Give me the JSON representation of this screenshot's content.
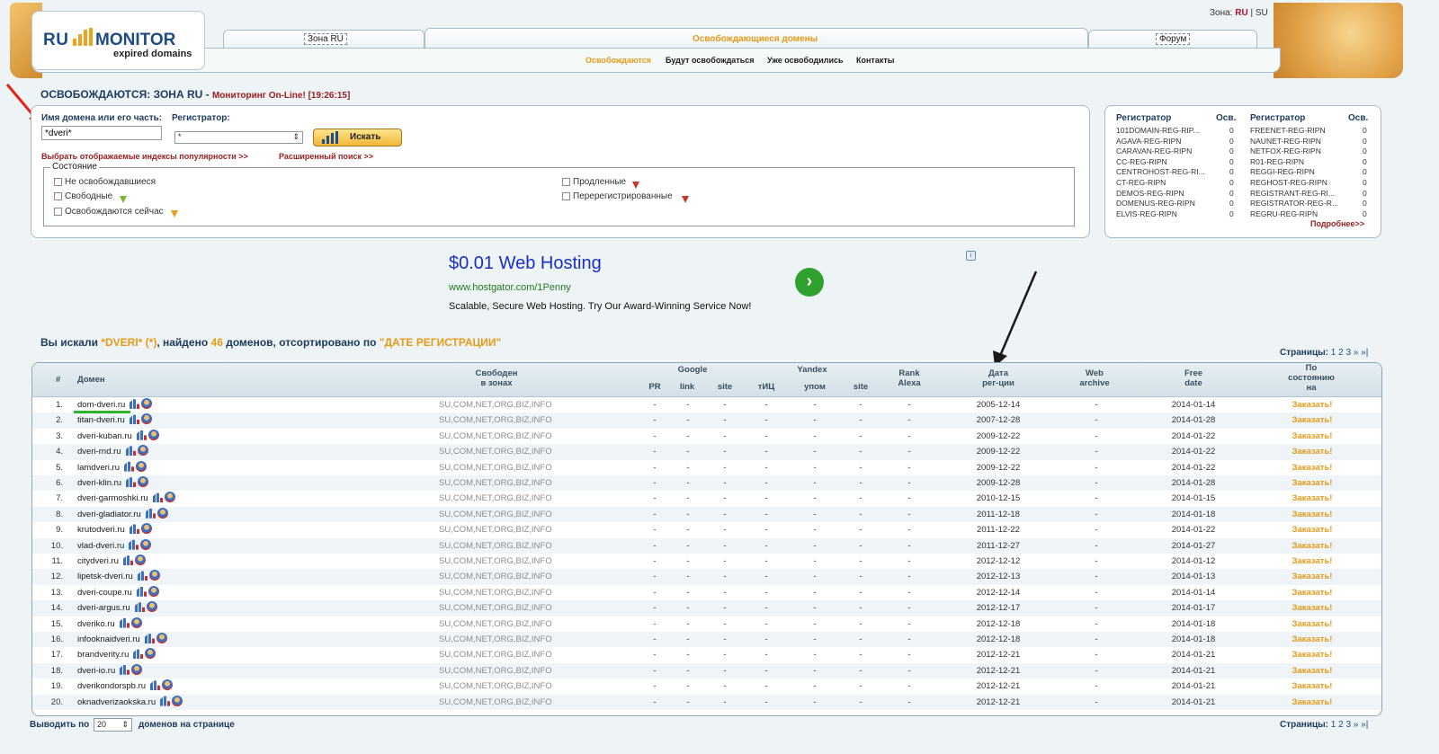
{
  "header": {
    "logo_ru": "RU",
    "logo_monitor": "MONITOR",
    "logo_sub": "expired domains",
    "zone_label": "Зона:",
    "zone_ru": "RU",
    "zone_sep": "|",
    "zone_su": "SU",
    "tabs": [
      {
        "label": "Зона RU"
      },
      {
        "label": "Освобождающиеся домены"
      },
      {
        "label": "Форум"
      }
    ],
    "subnav": [
      "Освобождаются",
      "Будут освобождаться",
      "Уже освободились",
      "Контакты"
    ],
    "colors": {
      "brand": "#1d4c86",
      "accent": "#e69a18",
      "alert": "#9b1c1c"
    }
  },
  "title": {
    "main": "ОСВОБОЖДАЮТСЯ: ЗОНА RU",
    "sep": "-",
    "monitor": "Мониторинг On-Line! [19:26:15]"
  },
  "search": {
    "domain_label": "Имя домена или его часть:",
    "registrar_label": "Регистратор:",
    "domain_value": "*dveri*",
    "registrar_value": "*",
    "button_label": "Искать",
    "link_indices": "Выбрать отображаемые индексы популярности >>",
    "link_advanced": "Расширенный поиск >>",
    "state_legend": "Состояние",
    "states": [
      "Не освобождавшиеся",
      "Свободные",
      "Освобождаются сейчас",
      "Продленные",
      "Перерегистрированные"
    ]
  },
  "registrars": {
    "head_name": "Регистратор",
    "head_count": "Осв.",
    "left": [
      {
        "name": "101DOMAIN-REG-RIP...",
        "count": "0"
      },
      {
        "name": "AGAVA-REG-RIPN",
        "count": "0"
      },
      {
        "name": "CARAVAN-REG-RIPN",
        "count": "0"
      },
      {
        "name": "CC-REG-RIPN",
        "count": "0"
      },
      {
        "name": "CENTROHOST-REG-RI...",
        "count": "0"
      },
      {
        "name": "CT-REG-RIPN",
        "count": "0"
      },
      {
        "name": "DEMOS-REG-RIPN",
        "count": "0"
      },
      {
        "name": "DOMENUS-REG-RIPN",
        "count": "0"
      },
      {
        "name": "ELVIS-REG-RIPN",
        "count": "0"
      }
    ],
    "right": [
      {
        "name": "FREENET-REG-RIPN",
        "count": "0"
      },
      {
        "name": "NAUNET-REG-RIPN",
        "count": "0"
      },
      {
        "name": "NETFOX-REG-RIPN",
        "count": "0"
      },
      {
        "name": "R01-REG-RIPN",
        "count": "0"
      },
      {
        "name": "REGGI-REG-RIPN",
        "count": "0"
      },
      {
        "name": "REGHOST-REG-RIPN",
        "count": "0"
      },
      {
        "name": "REGISTRANT-REG-RI...",
        "count": "0"
      },
      {
        "name": "REGISTRATOR-REG-R...",
        "count": "0"
      },
      {
        "name": "REGRU-REG-RIPN",
        "count": "0"
      }
    ],
    "more_link": "Подробнее>>"
  },
  "ad": {
    "title": "$0.01 Web Hosting",
    "url": "www.hostgator.com/1Penny",
    "desc": "Scalable, Secure Web Hosting. Try Our Award-Winning Service Now!",
    "go_glyph": "›",
    "info_glyph": "i"
  },
  "results": {
    "prefix": "Вы искали",
    "query": "*DVERI* (*)",
    "found_prefix": ", найдено",
    "count": "46",
    "found_suffix": "доменов, отсортировано по",
    "sort": "\"ДАТЕ РЕГИСТРАЦИИ\"",
    "pages_label": "Страницы:",
    "pages": "1 2 3 » »|"
  },
  "table": {
    "headers": {
      "num": "#",
      "domain": "Домен",
      "free_in_1": "Свободен",
      "free_in_2": "в зонах",
      "google": "Google",
      "pr": "PR",
      "link": "link",
      "site": "site",
      "yandex": "Yandex",
      "tic": "тИЦ",
      "upom": "упом",
      "ysite": "site",
      "rank_1": "Rank",
      "rank_2": "Alexa",
      "regdate_1": "Дата",
      "regdate_2": "рег-ции",
      "archive_1": "Web",
      "archive_2": "archive",
      "freedate_1": "Free",
      "freedate_2": "date",
      "bystate_1": "По",
      "bystate_2": "состоянию",
      "bystate_3": "на"
    },
    "rows": [
      {
        "n": "1.",
        "domain": "dom-dveri.ru",
        "zones": "SU,COM,NET,ORG,BIZ,INFO",
        "reg": "2005-12-14",
        "free": "2014-01-14",
        "dash": "-",
        "order": "Заказать!"
      },
      {
        "n": "2.",
        "domain": "titan-dveri.ru",
        "zones": "SU,COM,NET,ORG,BIZ,INFO",
        "reg": "2007-12-28",
        "free": "2014-01-28",
        "dash": "-",
        "order": "Заказать!"
      },
      {
        "n": "3.",
        "domain": "dveri-kuban.ru",
        "zones": "SU,COM,NET,ORG,BIZ,INFO",
        "reg": "2009-12-22",
        "free": "2014-01-22",
        "dash": "-",
        "order": "Заказать!"
      },
      {
        "n": "4.",
        "domain": "dveri-rnd.ru",
        "zones": "SU,COM,NET,ORG,BIZ,INFO",
        "reg": "2009-12-22",
        "free": "2014-01-22",
        "dash": "-",
        "order": "Заказать!"
      },
      {
        "n": "5.",
        "domain": "lamdveri.ru",
        "zones": "SU,COM,NET,ORG,BIZ,INFO",
        "reg": "2009-12-22",
        "free": "2014-01-22",
        "dash": "-",
        "order": "Заказать!"
      },
      {
        "n": "6.",
        "domain": "dveri-klin.ru",
        "zones": "SU,COM,NET,ORG,BIZ,INFO",
        "reg": "2009-12-28",
        "free": "2014-01-28",
        "dash": "-",
        "order": "Заказать!"
      },
      {
        "n": "7.",
        "domain": "dveri-garmoshki.ru",
        "zones": "SU,COM,NET,ORG,BIZ,INFO",
        "reg": "2010-12-15",
        "free": "2014-01-15",
        "dash": "-",
        "order": "Заказать!"
      },
      {
        "n": "8.",
        "domain": "dveri-gladiator.ru",
        "zones": "SU,COM,NET,ORG,BIZ,INFO",
        "reg": "2011-12-18",
        "free": "2014-01-18",
        "dash": "-",
        "order": "Заказать!"
      },
      {
        "n": "9.",
        "domain": "krutodveri.ru",
        "zones": "SU,COM,NET,ORG,BIZ,INFO",
        "reg": "2011-12-22",
        "free": "2014-01-22",
        "dash": "-",
        "order": "Заказать!"
      },
      {
        "n": "10.",
        "domain": "vlad-dveri.ru",
        "zones": "SU,COM,NET,ORG,BIZ,INFO",
        "reg": "2011-12-27",
        "free": "2014-01-27",
        "dash": "-",
        "order": "Заказать!"
      },
      {
        "n": "11.",
        "domain": "citydveri.ru",
        "zones": "SU,COM,NET,ORG,BIZ,INFO",
        "reg": "2012-12-12",
        "free": "2014-01-12",
        "dash": "-",
        "order": "Заказать!"
      },
      {
        "n": "12.",
        "domain": "lipetsk-dveri.ru",
        "zones": "SU,COM,NET,ORG,BIZ,INFO",
        "reg": "2012-12-13",
        "free": "2014-01-13",
        "dash": "-",
        "order": "Заказать!"
      },
      {
        "n": "13.",
        "domain": "dveri-coupe.ru",
        "zones": "SU,COM,NET,ORG,BIZ,INFO",
        "reg": "2012-12-14",
        "free": "2014-01-14",
        "dash": "-",
        "order": "Заказать!"
      },
      {
        "n": "14.",
        "domain": "dveri-argus.ru",
        "zones": "SU,COM,NET,ORG,BIZ,INFO",
        "reg": "2012-12-17",
        "free": "2014-01-17",
        "dash": "-",
        "order": "Заказать!"
      },
      {
        "n": "15.",
        "domain": "dveriko.ru",
        "zones": "SU,COM,NET,ORG,BIZ,INFO",
        "reg": "2012-12-18",
        "free": "2014-01-18",
        "dash": "-",
        "order": "Заказать!"
      },
      {
        "n": "16.",
        "domain": "infooknaidveri.ru",
        "zones": "SU,COM,NET,ORG,BIZ,INFO",
        "reg": "2012-12-18",
        "free": "2014-01-18",
        "dash": "-",
        "order": "Заказать!"
      },
      {
        "n": "17.",
        "domain": "brandverity.ru",
        "zones": "SU,COM,NET,ORG,BIZ,INFO",
        "reg": "2012-12-21",
        "free": "2014-01-21",
        "dash": "-",
        "order": "Заказать!"
      },
      {
        "n": "18.",
        "domain": "dveri-io.ru",
        "zones": "SU,COM,NET,ORG,BIZ,INFO",
        "reg": "2012-12-21",
        "free": "2014-01-21",
        "dash": "-",
        "order": "Заказать!"
      },
      {
        "n": "19.",
        "domain": "dverikondorspb.ru",
        "zones": "SU,COM,NET,ORG,BIZ,INFO",
        "reg": "2012-12-21",
        "free": "2014-01-21",
        "dash": "-",
        "order": "Заказать!"
      },
      {
        "n": "20.",
        "domain": "oknadverizaokska.ru",
        "zones": "SU,COM,NET,ORG,BIZ,INFO",
        "reg": "2012-12-21",
        "free": "2014-01-21",
        "dash": "-",
        "order": "Заказать!"
      }
    ]
  },
  "footer": {
    "per_page_label": "Выводить по",
    "per_page_value": "20",
    "per_page_suffix": "доменов на странице"
  }
}
